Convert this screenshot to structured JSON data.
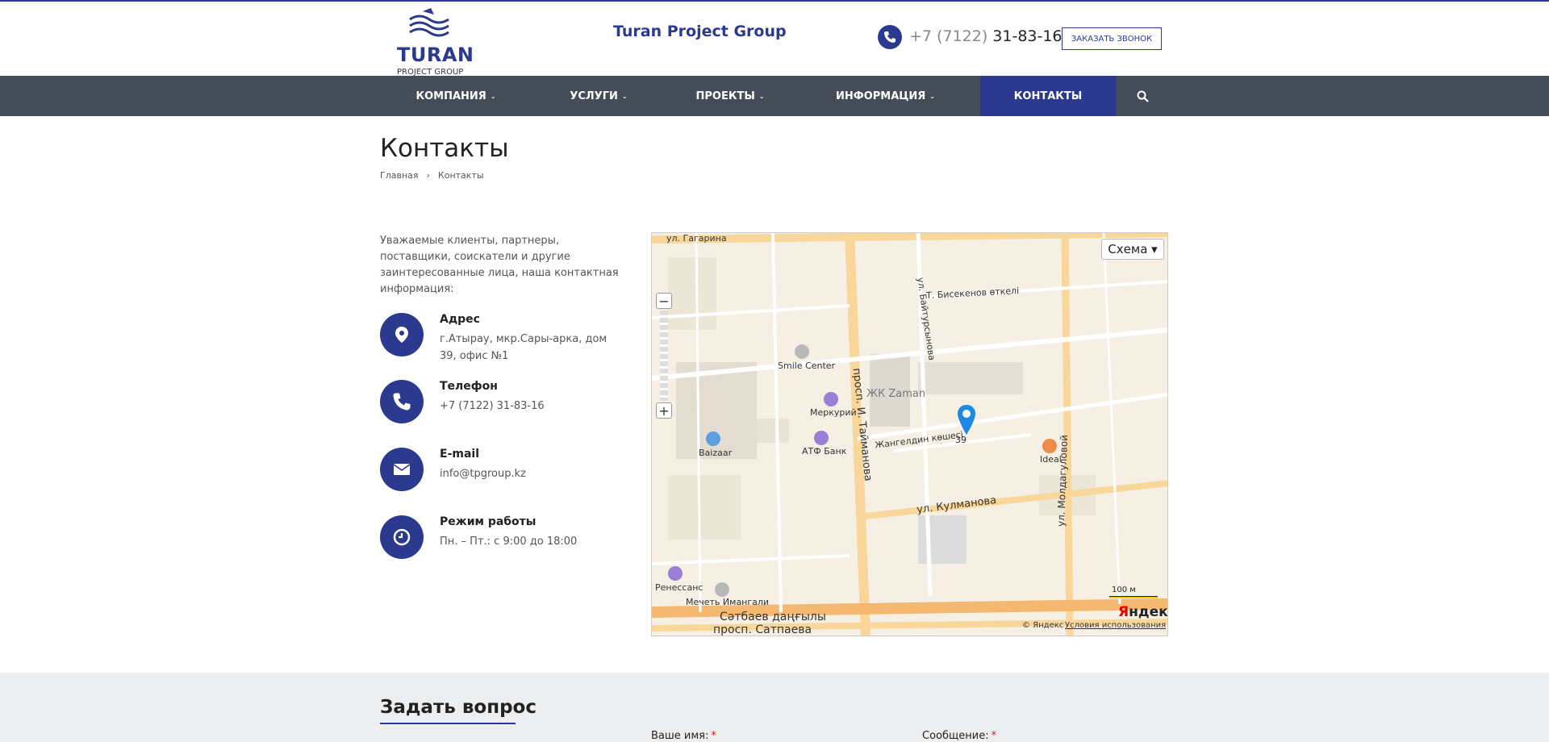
{
  "header": {
    "logo_big": "TURAN",
    "logo_small": "PROJECT GROUP",
    "company_name": "Turan Project Group",
    "phone_code": "+7 (7122)",
    "phone_number": "31-83-16",
    "callback_label": "ЗАКАЗАТЬ ЗВОНОК"
  },
  "nav": {
    "items": [
      {
        "label": "КОМПАНИЯ",
        "chevron": "⌄"
      },
      {
        "label": "УСЛУГИ",
        "chevron": "⌄"
      },
      {
        "label": "ПРОЕКТЫ",
        "chevron": "⌄"
      },
      {
        "label": "ИНФОРМАЦИЯ",
        "chevron": "⌄"
      },
      {
        "label": "КОНТАКТЫ"
      }
    ],
    "active_index": 4,
    "search_icon": "search-icon"
  },
  "page": {
    "title": "Контакты",
    "breadcrumb": {
      "home": "Главная",
      "separator": "›",
      "current": "Контакты"
    }
  },
  "intro": "Уважаемые клиенты, партнеры, поставщики, соискатели и другие заинтересованные лица, наша контактная информация:",
  "contacts": [
    {
      "title": "Адрес",
      "value": "г.Атырау, мкр.Сары-арка, дом 39, офис №1",
      "icon": "location-pin-icon"
    },
    {
      "title": "Телефон",
      "value": "+7 (7122) 31-83-16",
      "icon": "phone-icon"
    },
    {
      "title": "E-mail",
      "value": "info@tpgroup.kz",
      "icon": "envelope-icon"
    },
    {
      "title": "Режим работы",
      "value": "Пн. – Пт.: с 9:00 до 18:00",
      "icon": "clock-icon"
    }
  ],
  "map": {
    "scheme_label": "Схема ▾",
    "zoom_out": "−",
    "zoom_in": "+",
    "scale_label": "100 м",
    "copyright": "© Яндекс",
    "terms": "Условия использования",
    "logo_first": "Я",
    "logo_rest": "ндекс",
    "labels": [
      "ул. Гагарина",
      "Smile Center",
      "ЖК Zaman",
      "Меркурий",
      "АТФ Банк",
      "Baizaar",
      "Ideal",
      "ул. Кулманова",
      "просп. И. Тайманова",
      "ул. Молдагуловой",
      "Жангелдин көшесі",
      "Ренессанс",
      "Мечеть Имангали",
      "Сәтбаев даңғылы",
      "просп. Сатпаева",
      "Т. Бисекенов өткелі",
      "ул. Байтурсынова",
      "39"
    ]
  },
  "form": {
    "title": "Задать вопрос",
    "name_label": "Ваше имя:",
    "message_label": "Сообщение:",
    "required_mark": "*"
  },
  "colors": {
    "brand": "#2b3a8f",
    "nav_bg": "#434c57",
    "footer_bg": "#eceef0"
  }
}
